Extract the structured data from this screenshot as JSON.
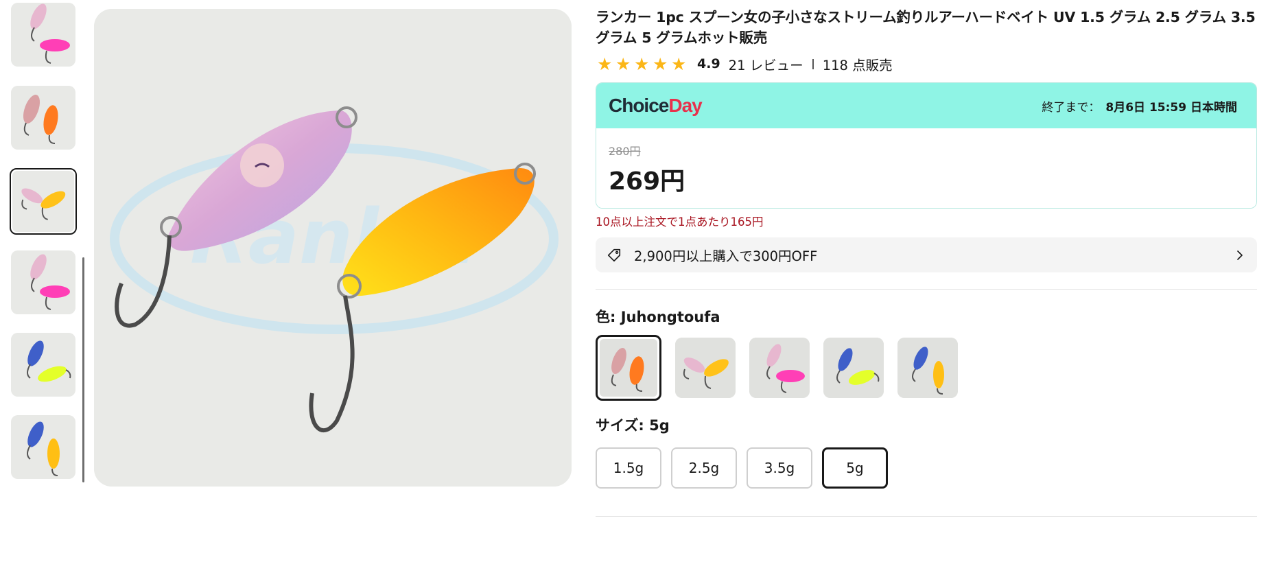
{
  "product": {
    "title": "ランカー 1pc スプーン女の子小さなストリーム釣りルアーハードベイト UV 1.5 グラム 2.5 グラム 3.5 グラム 5 グラムホット販売",
    "rating": "4.9",
    "stars": 5,
    "reviews": "21 レビュー",
    "sold": "118 点販売"
  },
  "promo": {
    "brand_choice": "Choice",
    "brand_day": "Day",
    "ends_label": "終了まで：",
    "ends_time": "8月6日 15:59 日本時間",
    "old_price": "280円",
    "price": "269円",
    "bulk_offer": "10点以上注文で1点あたり165円"
  },
  "coupon": {
    "text": "2,900円以上購入で300円OFF"
  },
  "options": {
    "color_label": "色: Juhongtoufa",
    "size_label": "サイズ: 5g",
    "sizes": [
      "1.5g",
      "2.5g",
      "3.5g",
      "5g"
    ],
    "selected_size": "5g"
  },
  "colors": {
    "accent_star": "#fbb617",
    "choice_bg": "#8ff4e5",
    "bulk_red": "#a8131f"
  }
}
